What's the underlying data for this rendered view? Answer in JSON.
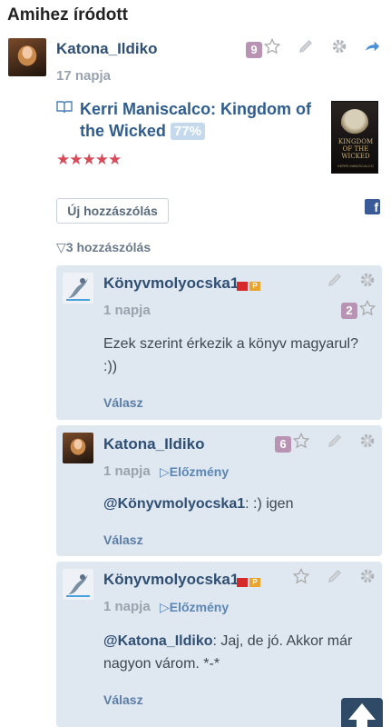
{
  "section": {
    "title": "Amihez íródott"
  },
  "post": {
    "author": "Katona_Ildiko",
    "time": "17 napja",
    "like_count": "9",
    "book": {
      "title": "Kerri Maniscalco: Kingdom of the Wicked",
      "progress": "77%"
    },
    "cover": {
      "title": "KINGDOM OF THE WICKED",
      "author": "KERRI MANISCALCO"
    },
    "rating": 5,
    "rating_stars": "★★★★★",
    "new_comment_label": "Új hozzászólás",
    "facebook_label": "f"
  },
  "comments_toggle": "▽3 hozzászólás",
  "comments": [
    {
      "author": "Könyvmolyocska1",
      "flag_p": "P",
      "time": "1 napja",
      "like_count": "2",
      "text": "Ezek szerint érkezik a könyv magyarul? :))",
      "reply_label": "Válasz"
    },
    {
      "author": "Katona_Ildiko",
      "time": "1 napja",
      "prev_label": "▷Előzmény",
      "like_count": "6",
      "mention": "@Könyvmolyocska1",
      "text": ": :) igen",
      "reply_label": "Válasz"
    },
    {
      "author": "Könyvmolyocska1",
      "flag_p": "P",
      "time": "1 napja",
      "prev_label": "▷Előzmény",
      "mention": "@Katona_Ildiko",
      "text": ": Jaj, de jó. Akkor már nagyon várom. *-*",
      "reply_label": "Válasz"
    }
  ],
  "colors": {
    "link": "#2f5d8f",
    "card_bg": "#dfe7f0",
    "badge": "#b993b3",
    "star_rating": "#d8495a"
  }
}
